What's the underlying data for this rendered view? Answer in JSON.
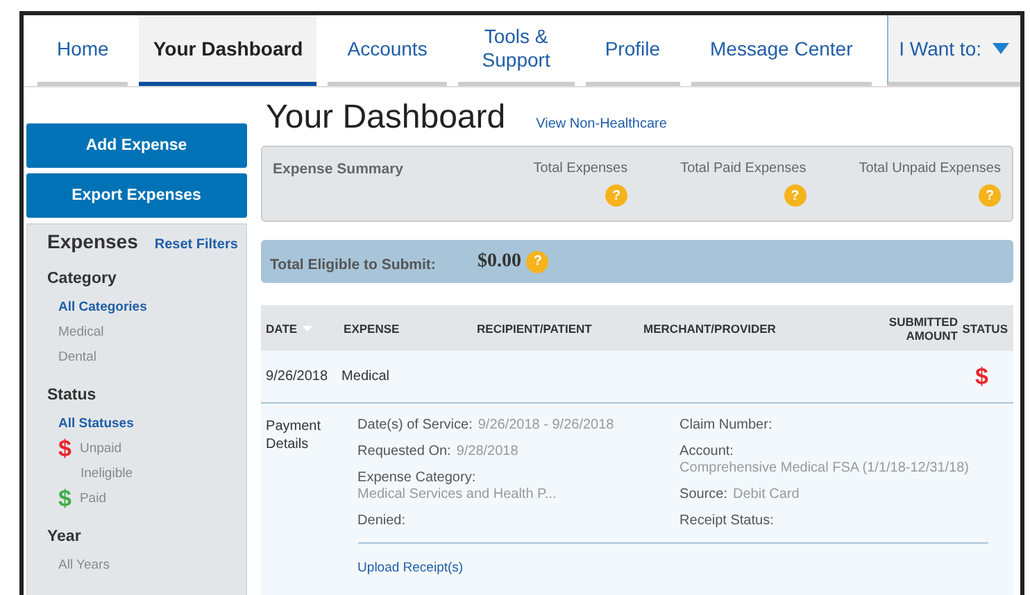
{
  "nav": {
    "tabs": [
      {
        "label": "Home",
        "selected": false
      },
      {
        "label": "Your Dashboard",
        "selected": true
      },
      {
        "label": "Accounts",
        "selected": false
      },
      {
        "label": "Tools & Support",
        "selected": false
      },
      {
        "label": "Profile",
        "selected": false
      },
      {
        "label": "Message Center",
        "selected": false
      }
    ],
    "menu": {
      "label": "I Want to:"
    }
  },
  "sidebar": {
    "buttons": [
      "Add Expense",
      "Export Expenses"
    ],
    "title": "Expenses",
    "reset": "Reset Filters",
    "groups": [
      {
        "title": "Category",
        "items": [
          {
            "label": "All Categories",
            "selected": true
          },
          {
            "label": "Medical",
            "selected": false
          },
          {
            "label": "Dental",
            "selected": false
          }
        ]
      },
      {
        "title": "Status",
        "items": [
          {
            "label": "All Statuses",
            "selected": true
          },
          {
            "label": "Unpaid",
            "selected": false,
            "icon": "$",
            "color": "#e8262b"
          },
          {
            "label": "Ineligible",
            "selected": false
          },
          {
            "label": "Paid",
            "selected": false,
            "icon": "$",
            "color": "#3fae49"
          }
        ]
      },
      {
        "title": "Year",
        "items": [
          {
            "label": "All Years",
            "selected": false
          }
        ]
      }
    ]
  },
  "main": {
    "title": "Your Dashboard",
    "link": "View Non-Healthcare",
    "summary": {
      "title": "Expense Summary",
      "totals": [
        {
          "label": "Total Expenses",
          "help": "?"
        },
        {
          "label": "Total Paid Expenses",
          "help": "?"
        },
        {
          "label": "Total Unpaid Expenses",
          "help": "?"
        }
      ]
    },
    "eligible": {
      "label": "Total Eligible to Submit:",
      "value": "$0.00",
      "help": "?"
    },
    "table": {
      "columns": [
        {
          "label": "DATE",
          "sorted": true
        },
        {
          "label": "EXPENSE",
          "sorted": false
        },
        {
          "label": "RECIPIENT/PATIENT",
          "sorted": false
        },
        {
          "label": "MERCHANT/PROVIDER",
          "sorted": false
        },
        {
          "label": "SUBMITTED AMOUNT",
          "sorted": false
        },
        {
          "label": "STATUS",
          "sorted": false
        }
      ],
      "rows": [
        {
          "date": "9/26/2018",
          "expense": "Medical",
          "status": "$",
          "color": "#e8262b"
        }
      ]
    },
    "details": {
      "title": "Payment Details",
      "left": [
        {
          "label": "Date(s) of Service:",
          "value": "9/26/2018 - 9/26/2018",
          "kind": "inline"
        },
        {
          "label": "Requested On:",
          "value": "9/28/2018",
          "kind": "inline"
        },
        {
          "label": "Expense Category:",
          "value": "Medical Services and Health P...",
          "kind": "stacked"
        },
        {
          "label": "Denied:",
          "kind": "inline"
        }
      ],
      "right": [
        {
          "label": "Claim Number:",
          "kind": "inline"
        },
        {
          "label": "Account:",
          "value": "Comprehensive Medical FSA (1/1/18-12/31/18)",
          "kind": "stacked"
        },
        {
          "label": "Source:",
          "value": "Debit Card",
          "kind": "inline"
        },
        {
          "label": "Receipt Status:",
          "kind": "inline"
        }
      ],
      "action": "Upload Receipt(s)"
    }
  }
}
